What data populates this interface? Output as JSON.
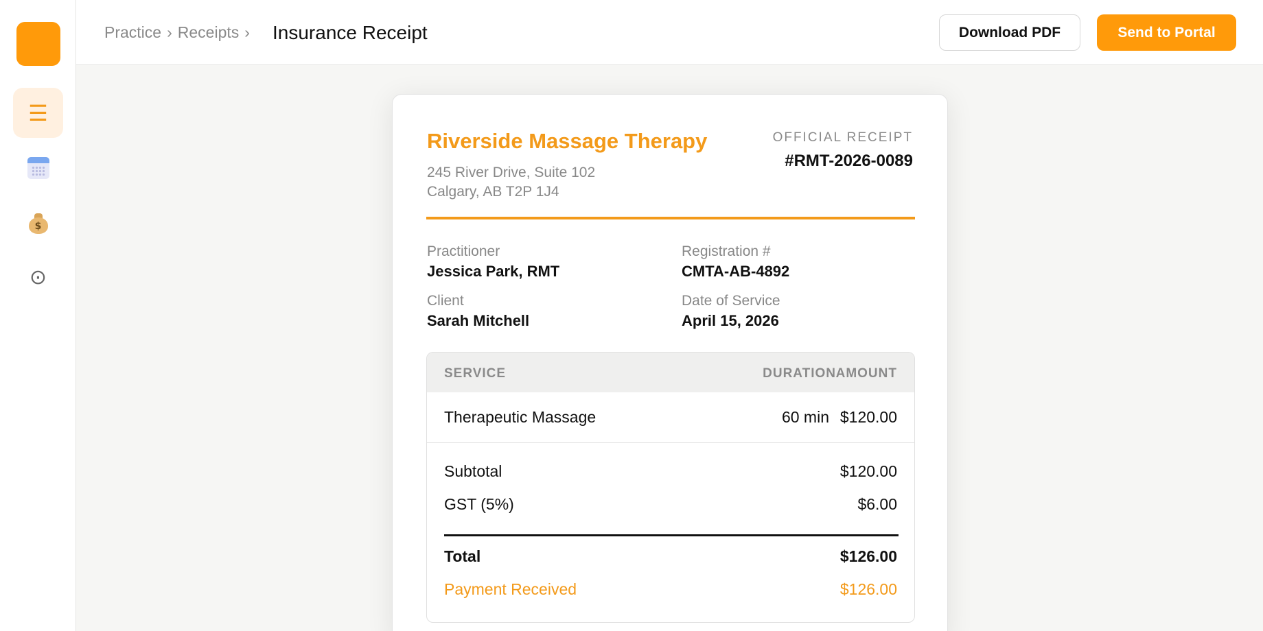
{
  "header": {
    "breadcrumb": [
      "Practice",
      "›",
      "Receipts",
      "›"
    ],
    "title": "Insurance Receipt",
    "download_label": "Download PDF",
    "send_label": "Send to Portal"
  },
  "sidebar": {
    "items": [
      {
        "name": "menu",
        "icon": "☰"
      },
      {
        "name": "calendar",
        "icon": "calendar-icon"
      },
      {
        "name": "billing",
        "icon": "$"
      },
      {
        "name": "settings",
        "icon": "⊙"
      }
    ]
  },
  "receipt": {
    "business_name": "Riverside Massage Therapy",
    "address_line1": "245 River Drive, Suite 102",
    "address_line2": "Calgary, AB T2P 1J4",
    "official_label": "OFFICIAL RECEIPT",
    "number": "#RMT-2026-0089",
    "practitioner_label": "Practitioner",
    "practitioner": "Jessica Park, RMT",
    "registration_label": "Registration #",
    "registration": "CMTA-AB-4892",
    "client_label": "Client",
    "client": "Sarah Mitchell",
    "date_label": "Date of Service",
    "date": "April 15, 2026",
    "table": {
      "headers": {
        "service": "SERVICE",
        "duration": "DURATION",
        "amount": "AMOUNT"
      },
      "rows": [
        {
          "service": "Therapeutic Massage",
          "duration": "60 min",
          "amount": "$120.00"
        }
      ]
    },
    "subtotal_label": "Subtotal",
    "subtotal": "$120.00",
    "tax_label": "GST (5%)",
    "tax": "$6.00",
    "total_label": "Total",
    "total": "$126.00",
    "payment_label": "Payment Received",
    "payment": "$126.00"
  },
  "colors": {
    "accent": "#ff9a0a",
    "accent_text": "#f39a1a"
  }
}
